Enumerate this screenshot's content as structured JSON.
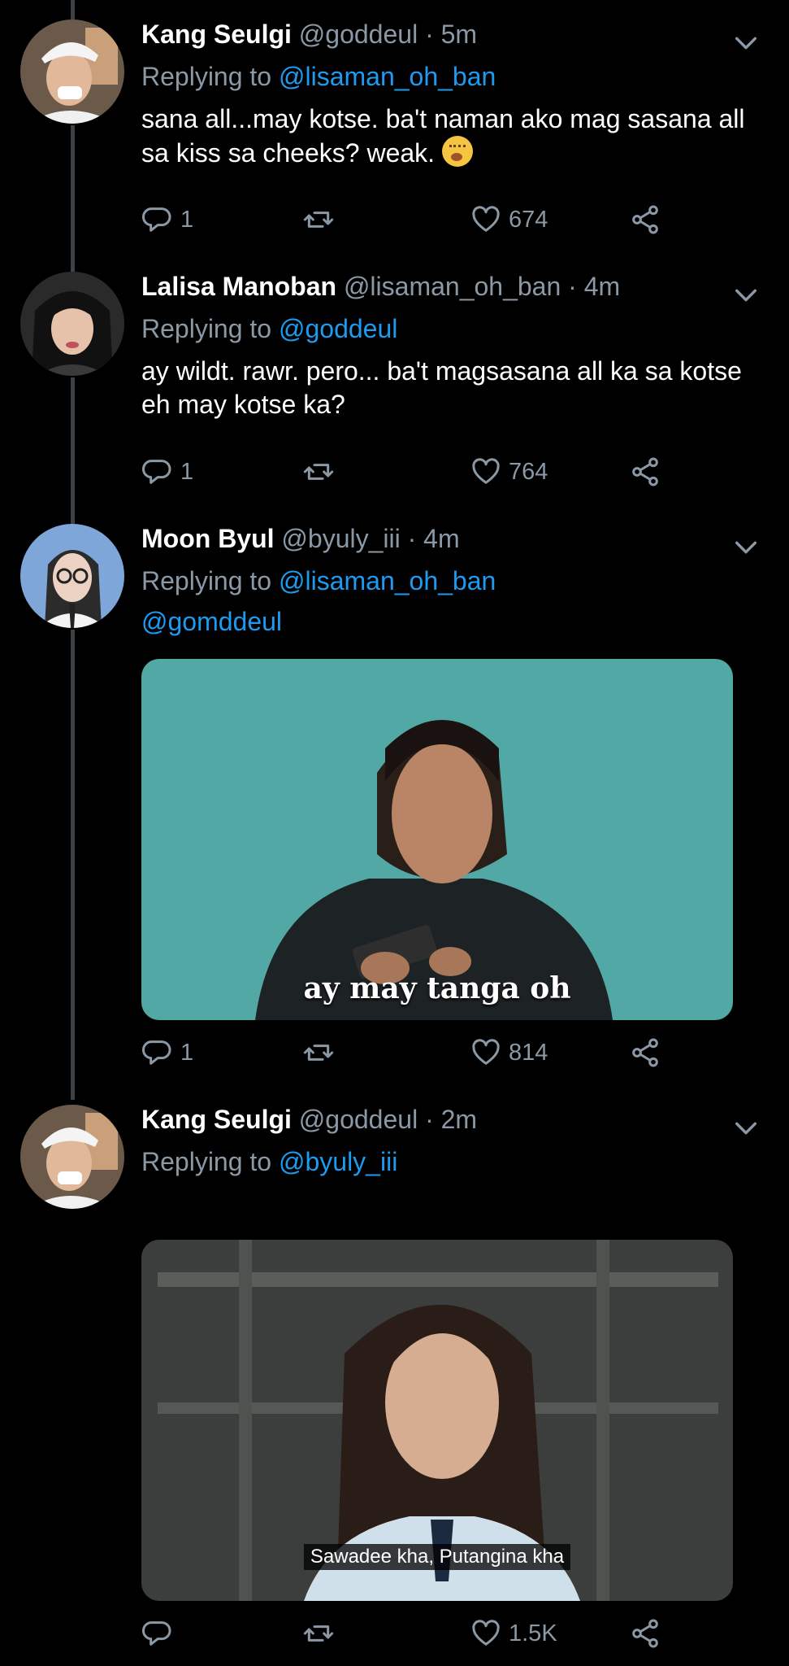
{
  "tweets": [
    {
      "name": "Kang Seulgi",
      "handle": "@goddeul",
      "time": "5m",
      "replying_prefix": "Replying to",
      "replying_to": "@lisaman_oh_ban",
      "body": "sana all...may kotse. ba't naman ako mag sasana all sa kiss sa cheeks? weak.",
      "emoji": "shushing-face-emoji",
      "replies": "1",
      "retweets": "",
      "likes": "674"
    },
    {
      "name": "Lalisa Manoban",
      "handle": "@lisaman_oh_ban",
      "time": "4m",
      "replying_prefix": "Replying to",
      "replying_to": "@goddeul",
      "body": "ay wildt. rawr. pero... ba't magsasana all ka sa kotse eh may kotse ka?",
      "replies": "1",
      "retweets": "",
      "likes": "764"
    },
    {
      "name": "Moon Byul",
      "handle": "@byuly_iii",
      "time": "4m",
      "replying_prefix": "Replying to",
      "replying_to": "@lisaman_oh_ban",
      "mention_line": "@gomddeul",
      "media_caption": "ay may tanga oh",
      "replies": "1",
      "retweets": "",
      "likes": "814"
    },
    {
      "name": "Kang Seulgi",
      "handle": "@goddeul",
      "time": "2m",
      "replying_prefix": "Replying to",
      "replying_to": "@byuly_iii",
      "media_caption": "Sawadee kha, Putangina kha",
      "replies": "",
      "retweets": "",
      "likes": "1.5K"
    }
  ],
  "separator": "·",
  "icons": [
    "reply-icon",
    "retweet-icon",
    "like-icon",
    "share-icon",
    "caret-down-icon"
  ],
  "colors": {
    "background": "#000000",
    "link": "#1d9bf0",
    "muted": "#8b98a5",
    "text": "#ffffff"
  }
}
